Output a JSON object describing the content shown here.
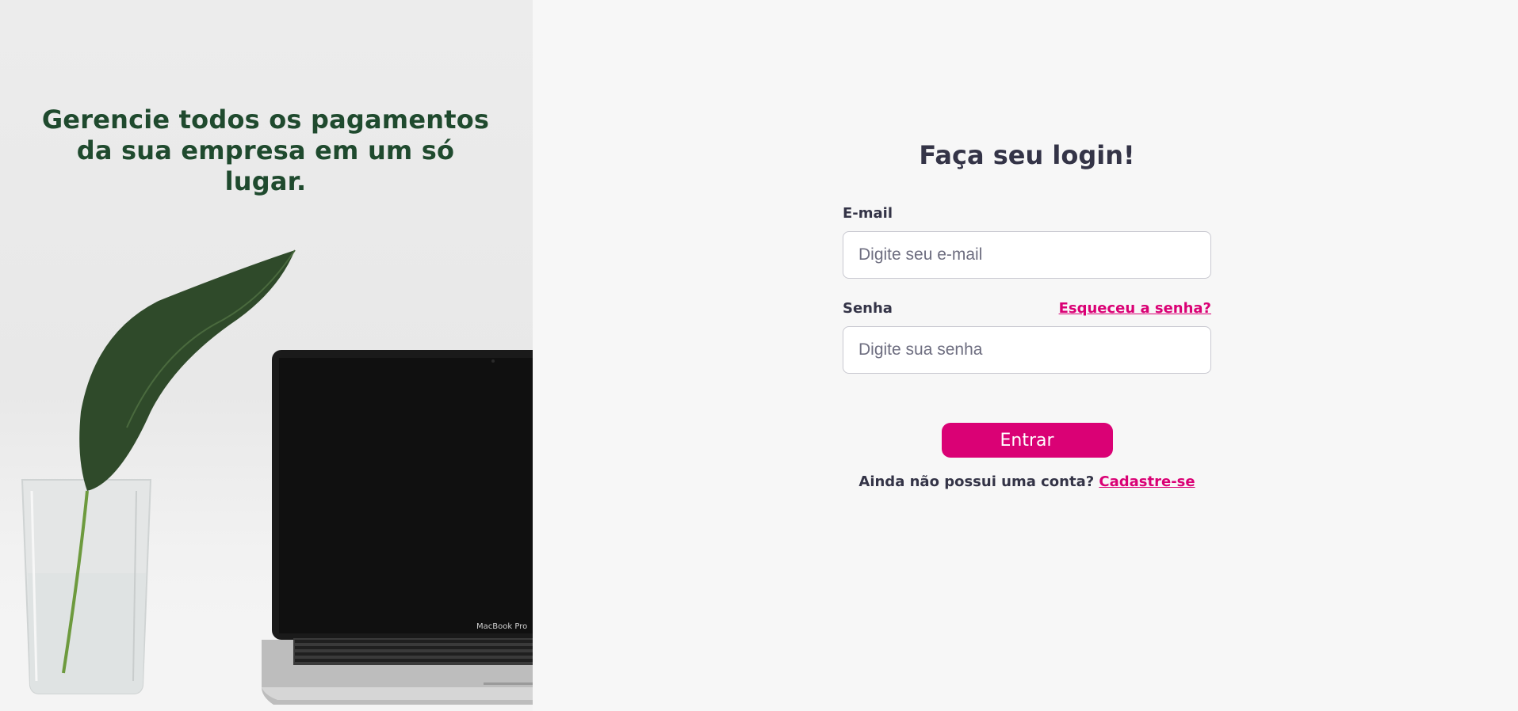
{
  "hero": {
    "headline": "Gerencie todos os pagamentos da sua empresa em um só lugar.",
    "image_description_icons": [
      "leaf-icon",
      "glass-vase-icon",
      "laptop-icon"
    ],
    "laptop_brand_text": "MacBook Pro"
  },
  "login": {
    "title": "Faça seu login!",
    "email_label": "E-mail",
    "email_placeholder": "Digite seu e-mail",
    "email_value": "",
    "password_label": "Senha",
    "forgot_password_link": "Esqueceu a senha?",
    "password_placeholder": "Digite sua senha",
    "password_value": "",
    "submit_label": "Entrar",
    "signup_prompt": "Ainda não possui uma conta?",
    "signup_link": "Cadastre-se"
  },
  "colors": {
    "accent": "#da0175",
    "headline_green": "#1f4a2e",
    "text_dark": "#343447",
    "background": "#f7f7f7"
  }
}
